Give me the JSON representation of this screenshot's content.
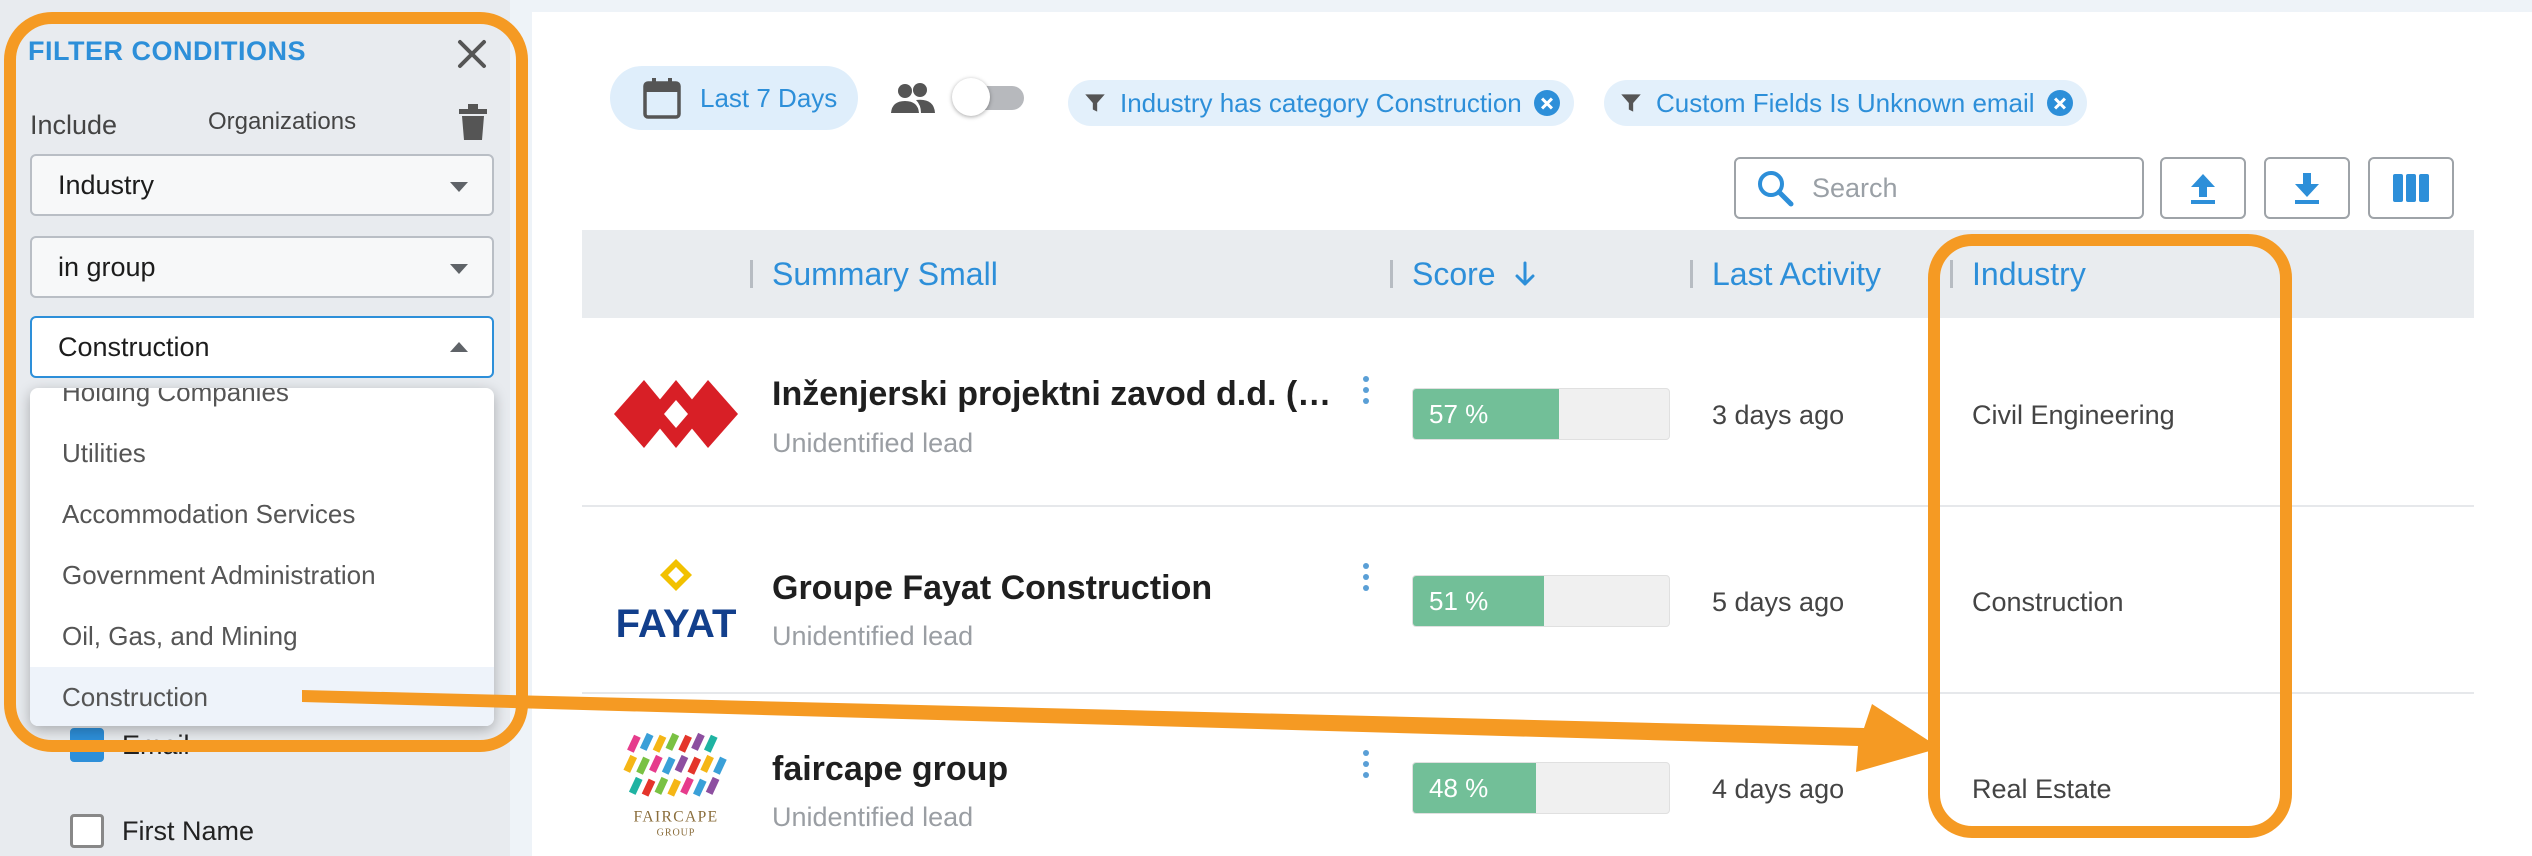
{
  "filter_panel": {
    "title": "FILTER CONDITIONS",
    "include_label": "Include",
    "entity_label": "Organizations",
    "field_select": "Industry",
    "operator_select": "in group",
    "value_select": "Construction",
    "dropdown_options": [
      "Holding Companies",
      "Utilities",
      "Accommodation Services",
      "Government Administration",
      "Oil, Gas, and Mining",
      "Construction"
    ],
    "selected_option": "Construction",
    "columns": [
      {
        "label": "Email",
        "checked": true
      },
      {
        "label": "First Name",
        "checked": false
      }
    ]
  },
  "toolbar": {
    "date_range": "Last 7 Days",
    "toggle_on": false,
    "filter_chips": [
      "Industry has category Construction",
      "Custom Fields Is Unknown email"
    ],
    "search_placeholder": "Search",
    "buttons": [
      "upload-icon",
      "download-icon",
      "columns-icon"
    ]
  },
  "table": {
    "headers": [
      "Summary Small",
      "Score",
      "Last Activity",
      "Industry"
    ],
    "sort": {
      "column": "Score",
      "direction": "descending"
    },
    "rows": [
      {
        "name": "Inženjerski projektni zavod d.d. (…",
        "status": "Unidentified lead",
        "score": 57,
        "score_label": "57 %",
        "last_activity": "3 days ago",
        "industry": "Civil Engineering",
        "logo": "red-diamond-logo"
      },
      {
        "name": "Groupe Fayat Construction",
        "status": "Unidentified lead",
        "score": 51,
        "score_label": "51 %",
        "last_activity": "5 days ago",
        "industry": "Construction",
        "logo_text": "FAYAT"
      },
      {
        "name": "faircape group",
        "status": "Unidentified lead",
        "score": 48,
        "score_label": "48 %",
        "last_activity": "4 days ago",
        "industry": "Real Estate",
        "logo_text": "FAIRCAPE",
        "logo_subtext": "GROUP"
      }
    ]
  },
  "colors": {
    "accent": "#2d8fd9",
    "highlight": "#f59a23",
    "score_fill": "#72bf98"
  }
}
